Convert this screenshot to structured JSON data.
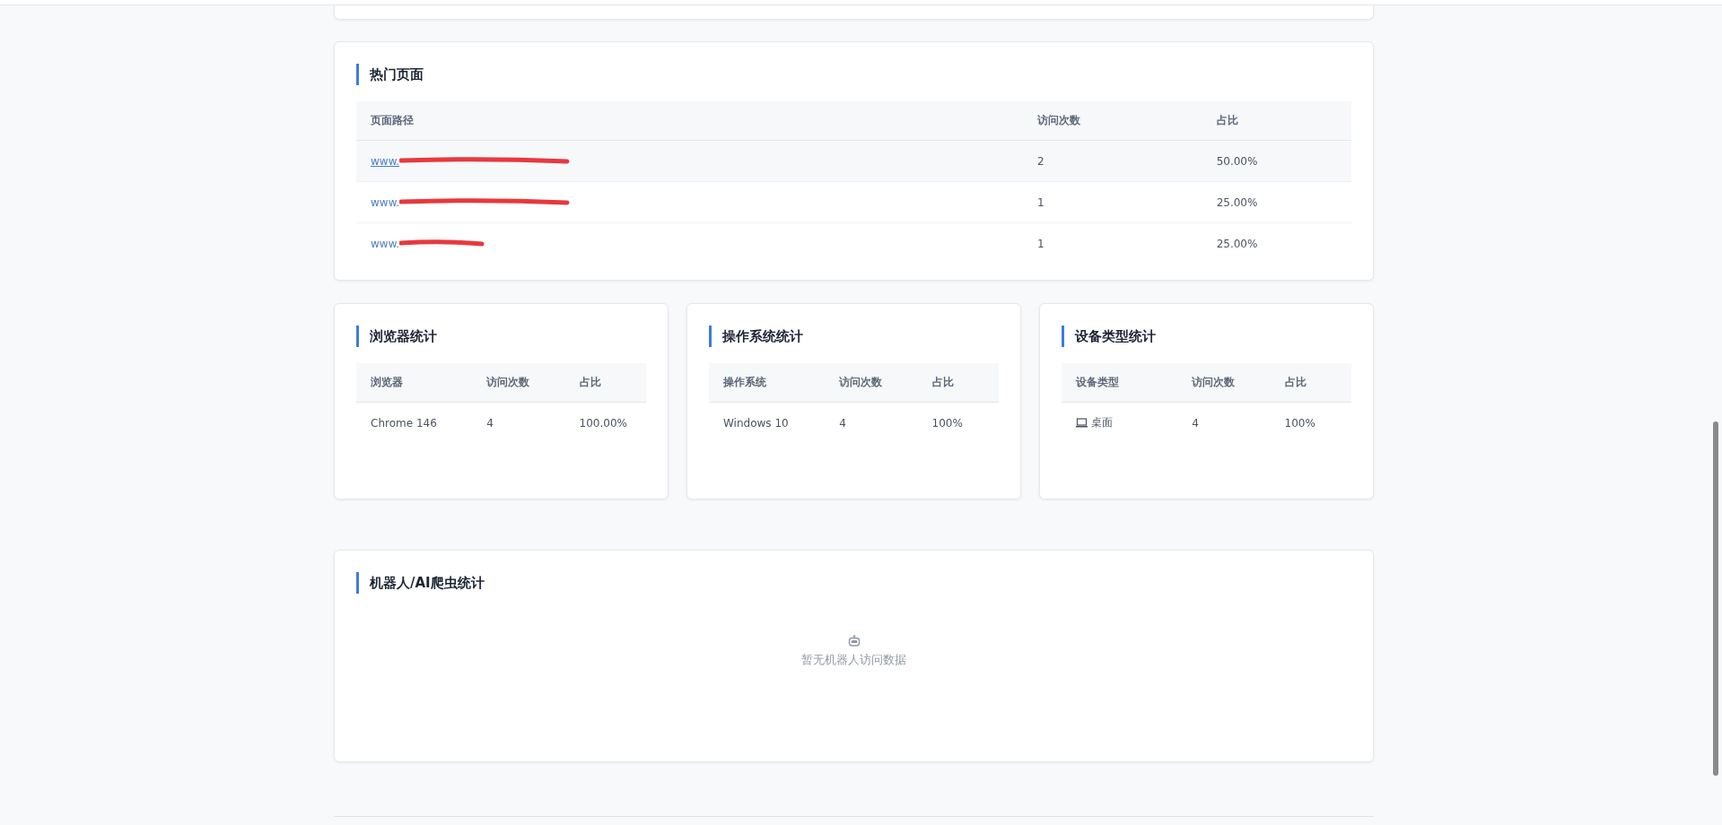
{
  "hot_pages": {
    "title": "热门页面",
    "columns": [
      "页面路径",
      "访问次数",
      "占比"
    ],
    "rows": [
      {
        "path": "www.",
        "visits": "2",
        "share": "50.00%",
        "hovered": true
      },
      {
        "path": "www.",
        "visits": "1",
        "share": "25.00%",
        "hovered": false
      },
      {
        "path": "www.",
        "visits": "1",
        "share": "25.00%",
        "hovered": false
      }
    ]
  },
  "stat_cards": [
    {
      "title": "浏览器统计",
      "columns": [
        "浏览器",
        "访问次数",
        "占比"
      ],
      "rows": [
        {
          "name": "Chrome 146",
          "visits": "4",
          "share": "100.00%"
        }
      ]
    },
    {
      "title": "操作系统统计",
      "columns": [
        "操作系统",
        "访问次数",
        "占比"
      ],
      "rows": [
        {
          "name": "Windows 10",
          "visits": "4",
          "share": "100%"
        }
      ]
    },
    {
      "title": "设备类型统计",
      "columns": [
        "设备类型",
        "访问次数",
        "占比"
      ],
      "rows": [
        {
          "name": "桌面",
          "kind": "desktop",
          "visits": "4",
          "share": "100%"
        }
      ]
    }
  ],
  "bot_stats": {
    "title": "机器人/AI爬虫统计",
    "empty_text": "暂无机器人访问数据"
  }
}
